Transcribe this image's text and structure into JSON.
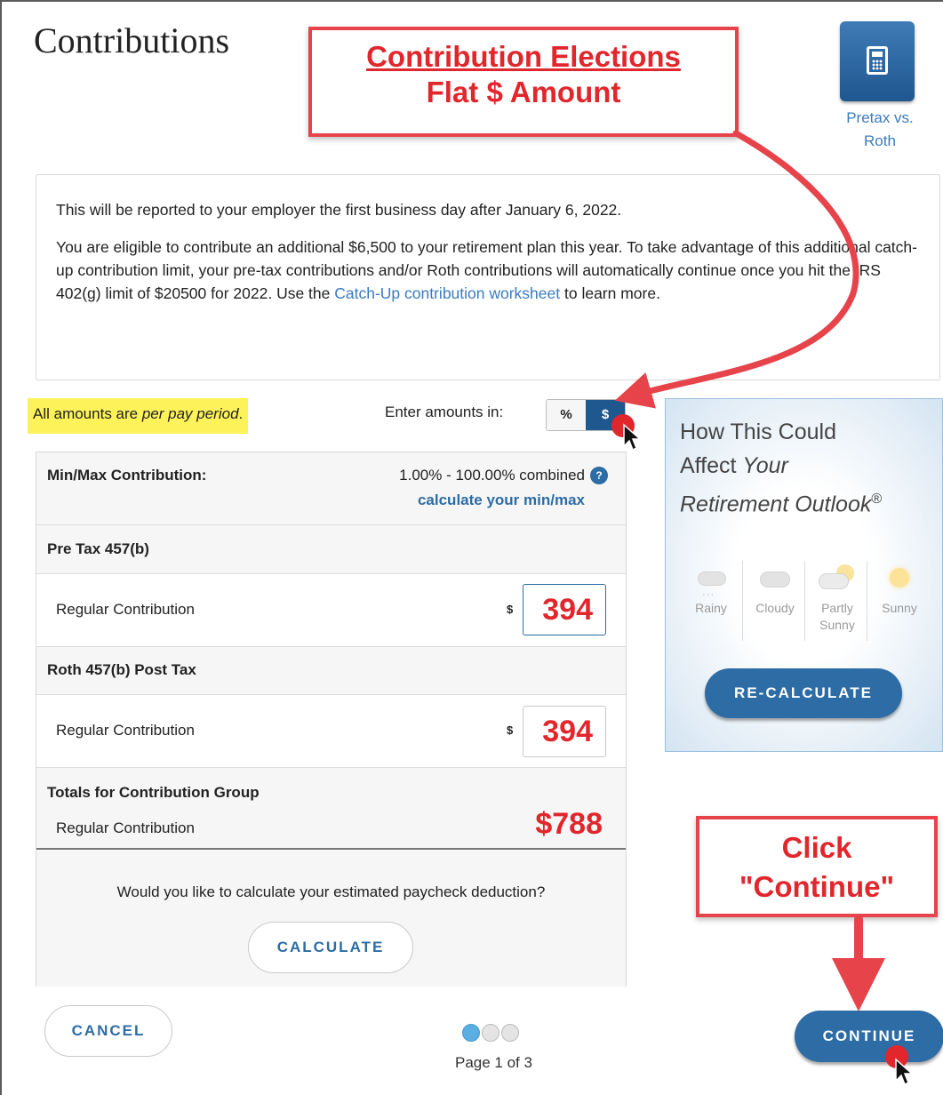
{
  "page": {
    "title": "Contributions"
  },
  "tool": {
    "caption_line1": "Pretax vs.",
    "caption_line2": "Roth"
  },
  "info": {
    "line1": "This will be reported to your employer the first business day after January 6, 2022.",
    "line2_text": "You are eligible to contribute an additional $6,500 to your retirement plan this year. To take advantage of this additional catch-up contribution limit, your pre-tax contributions and/or Roth contributions will automatically continue once you hit the IRS 402(g) limit of $20500 for 2022. Use the ",
    "link_text": "Catch-Up contribution worksheet",
    "line2_tail": " to learn more."
  },
  "note": {
    "prefix": "All amounts are ",
    "emphasis": "per pay period",
    "suffix": "."
  },
  "toggle": {
    "label": "Enter amounts in:",
    "percent": "%",
    "dollar": "$",
    "selected": "$"
  },
  "panel": {
    "minmax_label": "Min/Max Contribution:",
    "minmax_value": "1.00% - 100.00% combined",
    "minmax_link": "calculate your min/max",
    "help_glyph": "?",
    "groups": [
      {
        "name": "Pre Tax 457(b)",
        "row_label": "Regular Contribution",
        "currency": "$",
        "amount": "394"
      },
      {
        "name": "Roth 457(b) Post Tax",
        "row_label": "Regular Contribution",
        "currency": "$",
        "amount": "394"
      }
    ],
    "totals_label": "Totals for Contribution Group",
    "totals_row_label": "Regular Contribution",
    "totals_value": "$788",
    "paycheck_question": "Would you like to calculate your estimated paycheck deduction?",
    "calculate_btn": "CALCULATE"
  },
  "outlook": {
    "title_line1": "How This Could",
    "title_line2_prefix": "Affect ",
    "title_line2_em": "Your",
    "title_line3": "Retirement Outlook",
    "title_sup": "®",
    "weather": [
      {
        "label": "Rainy",
        "icon": "rain-cloud-icon"
      },
      {
        "label": "Cloudy",
        "icon": "cloud-icon"
      },
      {
        "label": "Partly Sunny",
        "icon": "partly-sunny-icon"
      },
      {
        "label": "Sunny",
        "icon": "sun-icon"
      }
    ],
    "recalculate_btn": "RE-CALCULATE"
  },
  "footer": {
    "cancel_btn": "CANCEL",
    "continue_btn": "CONTINUE",
    "page_label": "Page 1 of 3",
    "current_page": 1,
    "total_pages": 3
  },
  "annotations": {
    "top_line1": "Contribution Elections",
    "top_line2": "Flat $ Amount",
    "right_line1": "Click",
    "right_line2": "\"Continue\""
  },
  "colors": {
    "accent": "#2d6ca5",
    "link": "#3a7bbf",
    "annotation_red": "#e1262c",
    "highlight": "#fdf25a"
  }
}
